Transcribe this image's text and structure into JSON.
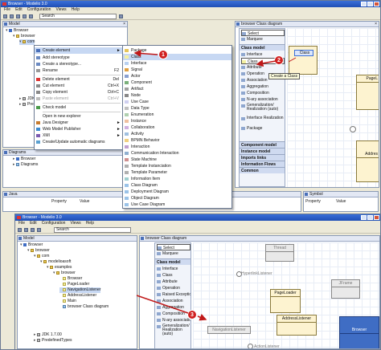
{
  "colors": {
    "accent": "#3a6fd8",
    "badge": "#d02020",
    "class_fill": "#fdf3d0",
    "arrow": "#c01818"
  },
  "win1": {
    "title": "Browser - Modelio 3.0",
    "menu": [
      "File",
      "Edit",
      "Configuration",
      "Views",
      "Help"
    ],
    "search_placeholder": "Search",
    "model_panel": {
      "title": "Model",
      "nodes": [
        "Browser",
        "browser",
        "com",
        "JDK 1.",
        "Predef"
      ]
    },
    "diagrams_panel": {
      "title": "Diagrams",
      "nodes": [
        "Browser",
        "Diagrams"
      ]
    },
    "java_panel": {
      "title": "Java",
      "columns": [
        "Property",
        "Value"
      ]
    },
    "symbol_panel": {
      "title": "Symbol",
      "columns": [
        "Property",
        "Value"
      ]
    },
    "diagram_tab": "browser Class diagram",
    "canvas_class": "Class",
    "canvas_tooltip": "Create a Class",
    "canvas_partial": [
      "PageL",
      "Addres"
    ]
  },
  "context_menu": {
    "items": [
      {
        "label": "Create element",
        "arrow": "►"
      },
      {
        "label": "Add stereotype"
      },
      {
        "label": "Create a stereotype..."
      },
      {
        "label": "Rename",
        "shortcut": "F2"
      },
      {
        "label": "Delete element",
        "shortcut": "Del"
      },
      {
        "label": "Cut element",
        "shortcut": "Ctrl+X"
      },
      {
        "label": "Copy element",
        "shortcut": "Ctrl+C"
      },
      {
        "label": "Paste element",
        "shortcut": "Ctrl+V"
      },
      {
        "label": "Check model"
      },
      {
        "label": "Open in new explorer"
      },
      {
        "label": "Java Designer",
        "arrow": "►"
      },
      {
        "label": "Web Model Publisher",
        "arrow": "►"
      },
      {
        "label": "XMI",
        "arrow": "►"
      },
      {
        "label": "Create/Update automatic diagrams"
      }
    ]
  },
  "submenu": {
    "items": [
      "Package",
      "Class",
      "Interface",
      "Signal",
      "Actor",
      "Component",
      "Artifact",
      "Node",
      "Use Case",
      "Data Type",
      "Enumeration",
      "Instance",
      "Collaboration",
      "Activity",
      "BPMN Behavior",
      "Interaction",
      "Communication Interaction",
      "State Machine",
      "Template Instanciation",
      "Template Parameter",
      "Information Item",
      "Class Diagram",
      "Deployment Diagram",
      "Object Diagram",
      "Use Case Diagram"
    ]
  },
  "palette1": {
    "top": [
      "Select",
      "Marquee"
    ],
    "group": "Class model",
    "items": [
      "Interface",
      "Class",
      "Attribute",
      "Operation",
      "Association",
      "Aggregation",
      "Composition",
      "N-ary association",
      "Generalization/ Realization (auto)",
      "Interface Realization",
      "Package"
    ],
    "groups": [
      "Component model",
      "Instance model",
      "Imports links",
      "Information Flows",
      "Common"
    ]
  },
  "win2": {
    "title": "Browser - Modelio 3.0",
    "menu": [
      "File",
      "Edit",
      "Configuration",
      "Views",
      "Help"
    ],
    "search_placeholder": "Search",
    "model_panel": {
      "title": "Model",
      "nodes": [
        "Browser",
        "browser",
        "com",
        "modelioasoft",
        "examples",
        "browser",
        "Browser",
        "PageLoader",
        "NavigationListener",
        "AddressListener",
        "Main",
        "browser Class diagram",
        "JDK 1.7.00",
        "PredefinedTypes"
      ]
    },
    "diagram_tab": "browser Class diagram",
    "palette": {
      "top": [
        "Select",
        "Marquee"
      ],
      "group": "Class model",
      "items": [
        "Interface",
        "Class",
        "Attribute",
        "Operation",
        "Raised Exception",
        "Association",
        "Aggregation",
        "Composition",
        "N-ary association",
        "Generalization/ Realization (auto)"
      ]
    },
    "canvas": {
      "classes": [
        "Thread",
        "PageLoader",
        "JFrame",
        "Browser",
        "NavigationListener"
      ],
      "interfaces": [
        "HyperlinkListener",
        "ActionListener"
      ]
    }
  },
  "badges": [
    "1",
    "2",
    "3"
  ]
}
